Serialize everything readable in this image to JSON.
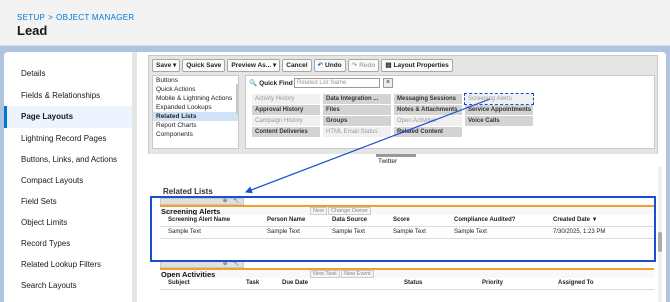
{
  "header": {
    "breadcrumb": [
      "SETUP",
      "OBJECT MANAGER"
    ],
    "title": "Lead"
  },
  "sidebar": {
    "items": [
      {
        "label": "Details"
      },
      {
        "label": "Fields & Relationships"
      },
      {
        "label": "Page Layouts",
        "active": true
      },
      {
        "label": "Lightning Record Pages"
      },
      {
        "label": "Buttons, Links, and Actions"
      },
      {
        "label": "Compact Layouts"
      },
      {
        "label": "Field Sets"
      },
      {
        "label": "Object Limits"
      },
      {
        "label": "Record Types"
      },
      {
        "label": "Related Lookup Filters"
      },
      {
        "label": "Search Layouts"
      }
    ]
  },
  "toolbar": {
    "save": "Save ▾",
    "quick_save": "Quick Save",
    "preview": "Preview As... ▾",
    "cancel": "Cancel",
    "undo": "Undo",
    "redo": "Redo",
    "layout_properties": "Layout Properties"
  },
  "palette": {
    "categories": [
      "Buttons",
      "Quick Actions",
      "Mobile & Lightning Actions",
      "Expanded Lookups",
      "Related Lists",
      "Report Charts",
      "Components"
    ],
    "selected_category": "Related Lists",
    "quick_find_label": "Quick Find",
    "quick_find_placeholder": "Related List Name",
    "tiles": [
      {
        "label": "Activity History",
        "used": true
      },
      {
        "label": "Approval History"
      },
      {
        "label": "Campaign History",
        "used": true
      },
      {
        "label": "Content Deliveries"
      },
      {
        "label": "Data Integration ..."
      },
      {
        "label": "Files"
      },
      {
        "label": "Groups"
      },
      {
        "label": "HTML Email Status",
        "used": true
      },
      {
        "label": "Messaging Sessions"
      },
      {
        "label": "Notes & Attachments"
      },
      {
        "label": "Open Activities",
        "used": true
      },
      {
        "label": "Related Content"
      },
      {
        "label": "Screening Alerts",
        "used": true,
        "target": true
      },
      {
        "label": "Service Appointments"
      },
      {
        "label": "Voice Calls"
      }
    ],
    "twitter": "Twitter"
  },
  "related_lists": {
    "heading": "Related Lists",
    "screening_alerts": {
      "title": "Screening Alerts",
      "buttons": [
        "New",
        "Change Owner"
      ],
      "columns": [
        "Screening Alert Name",
        "Person Name",
        "Data Source",
        "Score",
        "Compliance Audited?",
        "Created Date ▼"
      ],
      "row": [
        "Sample Text",
        "Sample Text",
        "Sample Text",
        "Sample Text",
        "Sample Text",
        "7/30/2025, 1:23 PM"
      ]
    },
    "open_activities": {
      "title": "Open Activities",
      "buttons": [
        "New Task",
        "New Event"
      ],
      "columns": [
        "Subject",
        "Task",
        "Due Date",
        "Status",
        "Priority",
        "Assigned To"
      ]
    }
  },
  "colors": {
    "accent": "#0176d3",
    "highlight": "#1a4fcf",
    "section_border": "#f0a030"
  }
}
